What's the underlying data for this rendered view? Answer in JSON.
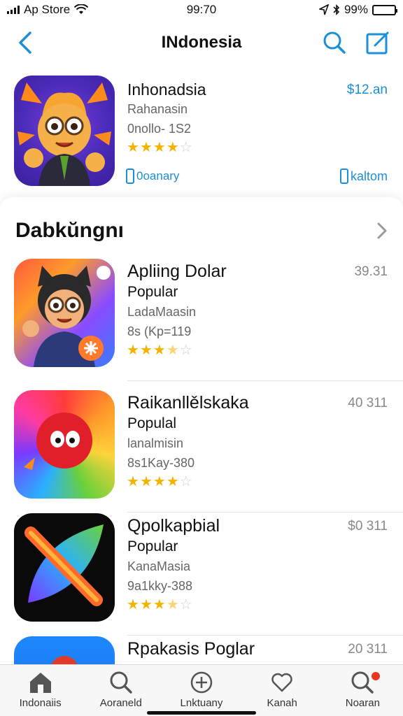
{
  "status_bar": {
    "carrier": "Ap Store",
    "time": "99:70",
    "battery": "99%",
    "battery_level": 0.9
  },
  "nav": {
    "title": "INdonesia",
    "back_icon": "chevron-left-icon",
    "search_icon": "search-icon",
    "compose_icon": "compose-icon"
  },
  "featured": {
    "title": "Inhonadsia",
    "subtitle": "Rahanasin",
    "code": "0nollo- 1S2",
    "price": "$12.an",
    "rating": 4,
    "link_left": "0oanary",
    "link_right": "kaltom"
  },
  "section": {
    "title": "Dabkŭngnı",
    "chevron_icon": "chevron-right-icon"
  },
  "apps": [
    {
      "name": "Apliing Dolar",
      "category": "Popular",
      "developer": "LadaMaasin",
      "code": "8s (Kp=119",
      "price": "39.31",
      "rating": 3.5
    },
    {
      "name": "Raikanllělskaka",
      "category": "Populal",
      "developer": "lanalmisin",
      "code": "8s1Kay-380",
      "price": "40 311",
      "rating": 4
    },
    {
      "name": "Qpolkapbial",
      "category": "Popular",
      "developer": "KanaMasia",
      "code": "9a1kky-388",
      "price": "$0 311",
      "rating": 3.5
    },
    {
      "name": "Rpakasis Poglar",
      "category": "",
      "developer": "",
      "code": "",
      "price": "20 311",
      "rating": 0
    }
  ],
  "tabs": [
    {
      "label": "Indonaiis",
      "icon": "home-icon"
    },
    {
      "label": "Aoraneld",
      "icon": "search-icon"
    },
    {
      "label": "Lnktuany",
      "icon": "plus-circle-icon"
    },
    {
      "label": "Kanah",
      "icon": "heart-icon"
    },
    {
      "label": "Noaran",
      "icon": "search-icon"
    }
  ],
  "colors": {
    "accent": "#1b8fd8",
    "star": "#f5b301",
    "badge": "#e8371f"
  }
}
